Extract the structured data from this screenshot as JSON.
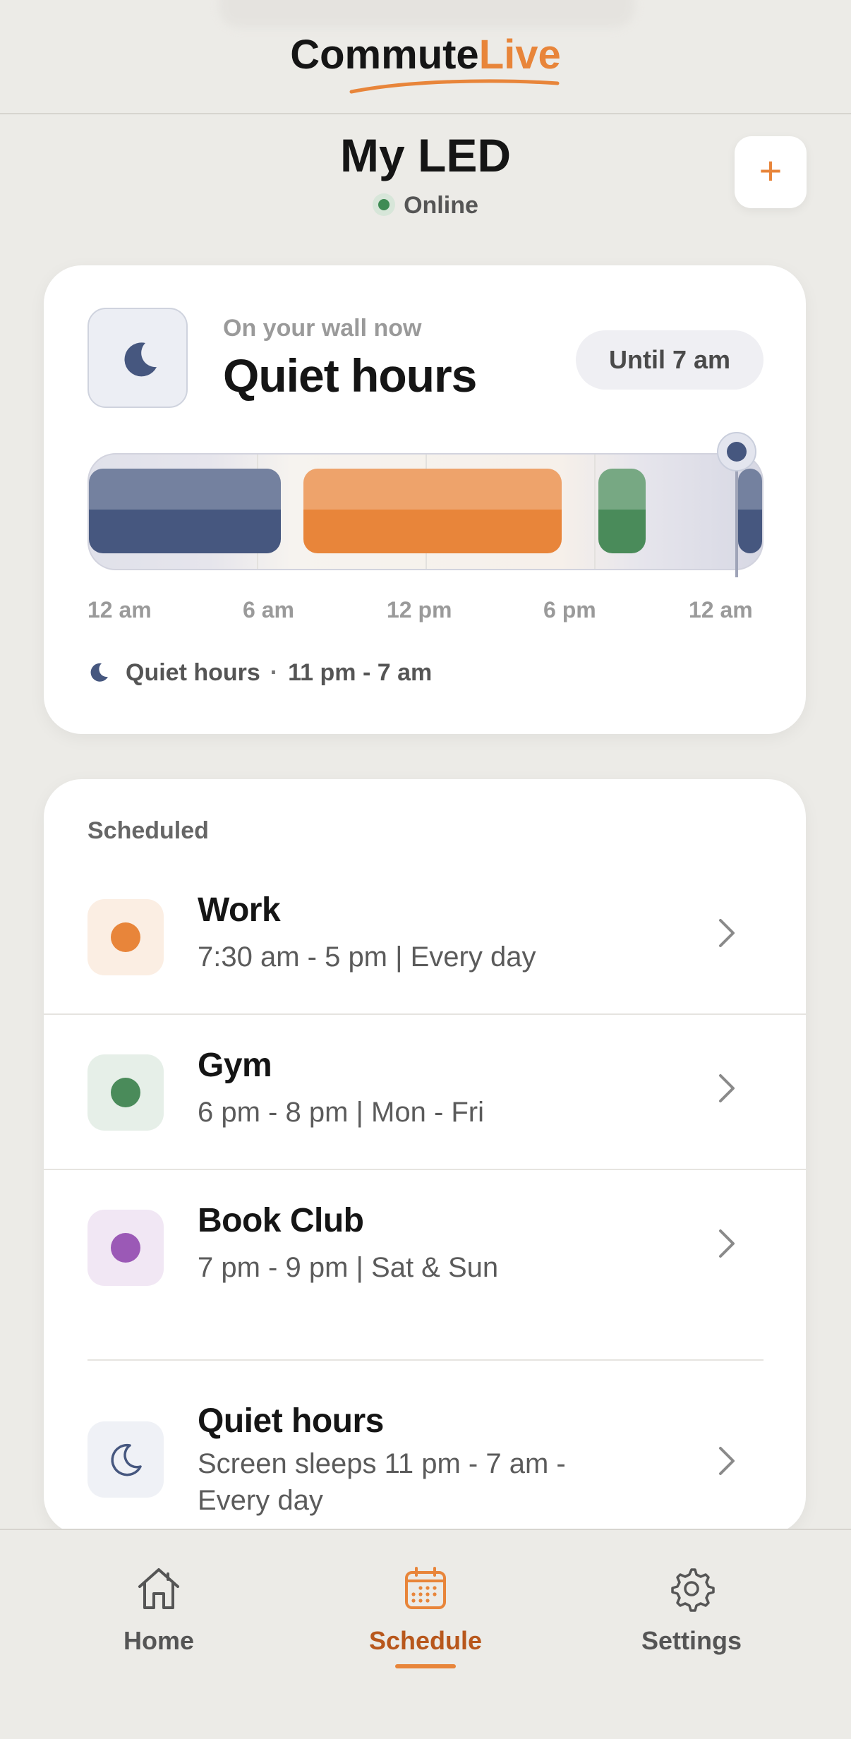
{
  "brand": {
    "part1": "Commute",
    "part2": "Live"
  },
  "device": {
    "name": "My LED",
    "status": "Online"
  },
  "header": {
    "add_label": "+"
  },
  "now": {
    "label": "On your wall now",
    "title": "Quiet hours",
    "until": "Until 7 am",
    "ticks": [
      "12 am",
      "6 am",
      "12 pm",
      "6 pm",
      "12 am"
    ],
    "legend_name": "Quiet hours",
    "legend_sep": "·",
    "legend_time": "11 pm - 7 am"
  },
  "timeline": {
    "hours_span": 24,
    "segments": [
      {
        "name": "quiet-hours",
        "start": 0,
        "end": 7,
        "color": "#46577f"
      },
      {
        "name": "work",
        "start": 7.5,
        "end": 17,
        "color": "#e8853a"
      },
      {
        "name": "gym",
        "start": 18,
        "end": 20,
        "color": "#4a8b5a"
      },
      {
        "name": "quiet-hours-evening",
        "start": 23,
        "end": 24,
        "color": "#46577f"
      }
    ],
    "now_hour": 23
  },
  "scheduled": {
    "heading": "Scheduled",
    "items": [
      {
        "title": "Work",
        "subtitle": "7:30 am - 5 pm | Every day",
        "dot": "#e8853a",
        "tile": "#fbeee3"
      },
      {
        "title": "Gym",
        "subtitle": "6 pm - 8 pm | Mon - Fri",
        "dot": "#4a8b5a",
        "tile": "#e6efe8"
      },
      {
        "title": "Book Club",
        "subtitle": "7 pm - 9 pm | Sat & Sun",
        "dot": "#9b59b6",
        "tile": "#f1e7f4"
      }
    ],
    "quiet": {
      "title": "Quiet hours",
      "subtitle_line1": "Screen sleeps 11 pm - 7 am -",
      "subtitle_line2": "Every day"
    }
  },
  "nav": {
    "home": "Home",
    "schedule": "Schedule",
    "settings": "Settings"
  },
  "colors": {
    "accent": "#e8853a",
    "night": "#46577f",
    "active_nav": "#b8571c"
  }
}
